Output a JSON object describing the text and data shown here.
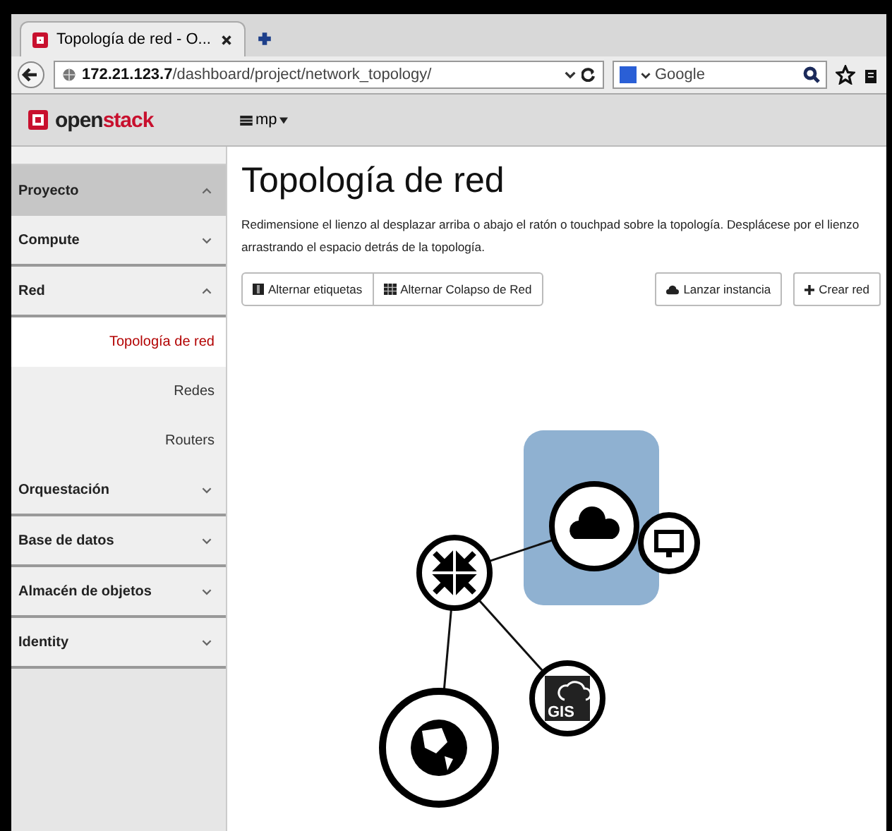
{
  "browser": {
    "tab": {
      "title": "Topología de red - O..."
    },
    "url": {
      "host": "172.21.123.7",
      "path": "/dashboard/project/network_topology/"
    },
    "search": {
      "engine": "Google"
    }
  },
  "header": {
    "brand": {
      "part_1": "open",
      "part_2": "stack"
    },
    "project": "mp"
  },
  "sidebar": {
    "items": [
      {
        "label": "Proyecto",
        "expanded": true,
        "children": [
          {
            "label": "Compute",
            "expanded": false
          },
          {
            "label": "Red",
            "expanded": true,
            "children": [
              {
                "label": "Topología de red",
                "selected": true
              },
              {
                "label": "Redes",
                "selected": false
              },
              {
                "label": "Routers",
                "selected": false
              }
            ]
          },
          {
            "label": "Orquestación",
            "expanded": false
          },
          {
            "label": "Base de datos",
            "expanded": false
          },
          {
            "label": "Almacén de objetos",
            "expanded": false
          }
        ]
      },
      {
        "label": "Identity",
        "expanded": false
      }
    ]
  },
  "page": {
    "title": "Topología de red",
    "description": "Redimensione el lienzo al desplazar arriba o abajo el ratón o touchpad sobre la topología. Desplácese por el lienzo arrastrando el espacio detrás de la topología.",
    "toggle_buttons": [
      "Alternar etiquetas",
      "Alternar Colapso de Red"
    ],
    "action_buttons": [
      {
        "kind": "launch",
        "label": "Lanzar instancia"
      },
      {
        "kind": "create",
        "label": "Crear red"
      }
    ]
  },
  "topology": {
    "nodes": [
      {
        "kind": "network"
      },
      {
        "kind": "instance"
      },
      {
        "kind": "router"
      },
      {
        "kind": "image",
        "label": "GIS"
      },
      {
        "kind": "external"
      }
    ]
  }
}
